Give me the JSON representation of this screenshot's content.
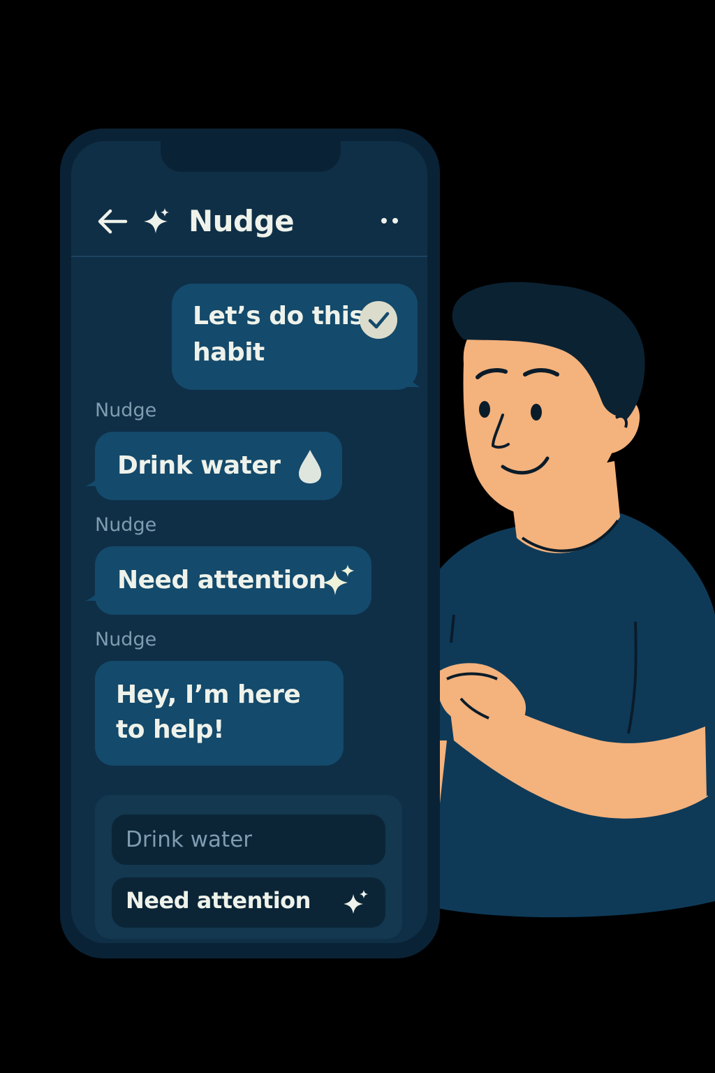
{
  "app": {
    "title": "Nudge",
    "icons": {
      "back": "back-arrow-icon",
      "logo": "sparkle-icon",
      "menu": "more-dots-icon"
    }
  },
  "messages": [
    {
      "from": "user",
      "text_line1": "Let’s do this",
      "text_line2": "habit",
      "icon": "check-circle-icon"
    },
    {
      "from": "Nudge",
      "text": "Drink water",
      "icon": "water-drop-icon"
    },
    {
      "from": "Nudge",
      "text": "Need attention",
      "icon": "sparkle-icon"
    },
    {
      "from": "Nudge",
      "text_line1": "Hey, I’m here",
      "text_line2": "to help!"
    }
  ],
  "composer": {
    "placeholder": "Drink water",
    "suggestion_label": "Need attention",
    "suggestion_icon": "sparkle-icon"
  },
  "colors": {
    "background": "#000000",
    "phone_frame": "#0a2235",
    "screen": "#0f2f47",
    "bubble": "#144a6b",
    "text": "#eef2ea",
    "muted": "#7f9cb0",
    "skin": "#f4b27c",
    "shirt": "#0e3a58"
  }
}
